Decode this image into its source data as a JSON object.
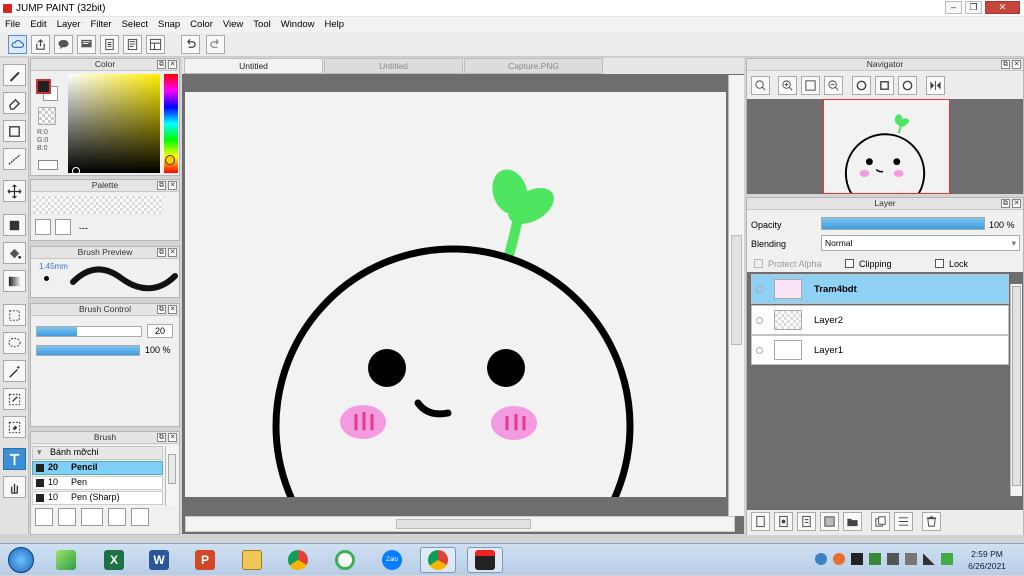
{
  "window": {
    "title": "JUMP PAINT (32bit)"
  },
  "menu": [
    "File",
    "Edit",
    "Layer",
    "Filter",
    "Select",
    "Snap",
    "Color",
    "View",
    "Tool",
    "Window",
    "Help"
  ],
  "color_panel": {
    "title": "Color",
    "r": "R:0",
    "g": "G:0",
    "b": "B:0"
  },
  "palette_panel": {
    "title": "Palette",
    "placeholder": "---"
  },
  "brush_preview": {
    "title": "Brush Preview",
    "size": "1.45mm"
  },
  "brush_control": {
    "title": "Brush Control",
    "size_value": "20",
    "opacity_value": "100 %",
    "size_fraction": 0.38,
    "opacity_fraction": 1.0
  },
  "brush_panel": {
    "title": "Brush",
    "group": "Bánh mỡchi",
    "items": [
      {
        "size": "20",
        "name": "Pencil"
      },
      {
        "size": "10",
        "name": "Pen"
      },
      {
        "size": "10",
        "name": "Pen (Sharp)"
      }
    ]
  },
  "tabs": [
    "Untitled",
    "Untitled",
    "Capture.PNG"
  ],
  "navigator": {
    "title": "Navigator"
  },
  "layer_panel": {
    "title": "Layer",
    "opacity_label": "Opacity",
    "opacity_value": "100 %",
    "opacity_fraction": 1.0,
    "blending_label": "Blending",
    "blending_value": "Normal",
    "protect_alpha": "Protect Alpha",
    "clipping": "Clipping",
    "lock": "Lock",
    "layers": [
      "Tram4bdt",
      "Layer2",
      "Layer1"
    ]
  },
  "taskbar": {
    "time": "2:59 PM",
    "date": "6/26/2021",
    "apps": [
      "start",
      "bluestacks",
      "excel",
      "word",
      "powerpoint",
      "explorer",
      "chrome",
      "coccoc",
      "zalo",
      "chrome",
      "jumppaint"
    ]
  },
  "colors": {
    "accent": "#3d8fd5",
    "sprout": "#4ee660",
    "blush": "#f49ae0",
    "blush_lines": "#e23b8a",
    "layer_selected": "#8fd1f5"
  }
}
